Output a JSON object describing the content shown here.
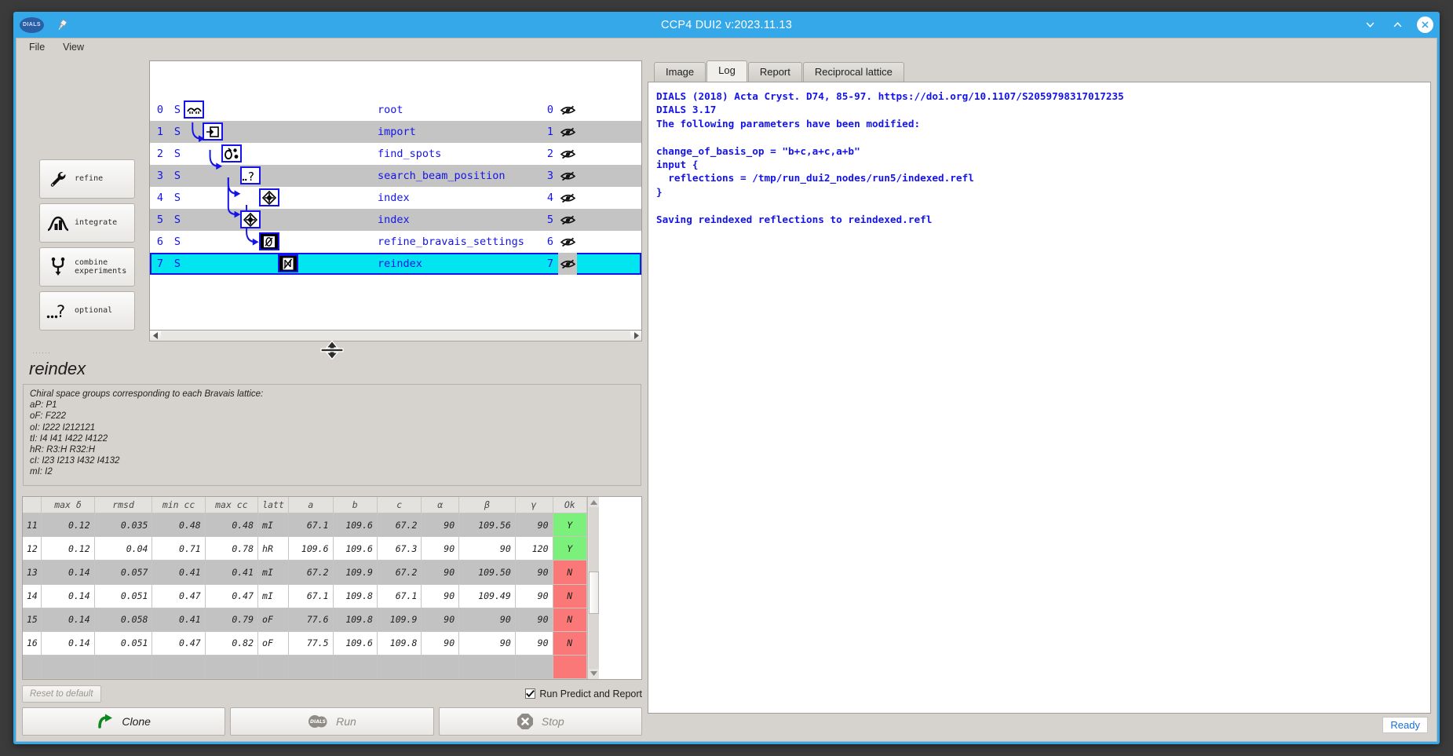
{
  "window": {
    "title": "CCP4 DUI2 v:2023.11.13",
    "logo_text": "DIALS",
    "controls": {
      "minimize": "chevron-down-icon",
      "maximize": "chevron-up-icon",
      "close": "close-icon"
    }
  },
  "menubar": {
    "items": [
      "File",
      "View"
    ]
  },
  "sidebuttons": [
    {
      "label": "refine",
      "icon": "wrench-icon"
    },
    {
      "label": "integrate",
      "icon": "histogram-icon"
    },
    {
      "label": "combine\nexperiments",
      "icon": "merge-icon"
    },
    {
      "label": "optional",
      "icon": "question-icon"
    }
  ],
  "tree": {
    "rows": [
      {
        "idx": "0",
        "status": "S",
        "name": "root",
        "num": "0",
        "icon": "eyelash-icon",
        "node_icon": "root-icon",
        "selected": false
      },
      {
        "idx": "1",
        "status": "S",
        "name": "import",
        "num": "1",
        "icon": "eyelash-icon",
        "node_icon": "import-icon",
        "selected": false
      },
      {
        "idx": "2",
        "status": "S",
        "name": "find_spots",
        "num": "2",
        "icon": "eyelash-icon",
        "node_icon": "spots-icon",
        "selected": false
      },
      {
        "idx": "3",
        "status": "S",
        "name": "search_beam_position",
        "num": "3",
        "icon": "eyelash-icon",
        "node_icon": "question-icon",
        "selected": false
      },
      {
        "idx": "4",
        "status": "S",
        "name": "index",
        "num": "4",
        "icon": "eyelash-icon",
        "node_icon": "index-icon",
        "selected": false
      },
      {
        "idx": "5",
        "status": "S",
        "name": "index",
        "num": "5",
        "icon": "eyelash-icon",
        "node_icon": "index-icon",
        "selected": false
      },
      {
        "idx": "6",
        "status": "S",
        "name": "refine_bravais_settings",
        "num": "6",
        "icon": "eyelash-icon",
        "node_icon": "bravais-icon",
        "selected": false
      },
      {
        "idx": "7",
        "status": "S",
        "name": "reindex",
        "num": "7",
        "icon": "eyelash-icon",
        "node_icon": "reindex-icon",
        "selected": true
      }
    ]
  },
  "reindex": {
    "title": "reindex",
    "description": [
      "Chiral space groups corresponding to each Bravais lattice:",
      "aP: P1",
      "oF: F222",
      "oI: I222 I212121",
      "tI: I4 I41 I422 I4122",
      "hR: R3:H R32:H",
      "cI: I23 I213 I432 I4132",
      "mI: I2"
    ]
  },
  "table": {
    "headers": [
      "max δ",
      "rmsd",
      "min cc",
      "max cc",
      "latt",
      "a",
      "b",
      "c",
      "α",
      "β",
      "γ",
      "Ok"
    ],
    "rows": [
      {
        "id": "11",
        "cells": [
          "0.12",
          "0.035",
          "0.48",
          "0.48",
          "mI",
          "67.1",
          "109.6",
          "67.2",
          "90",
          "109.56",
          "90"
        ],
        "ok": "Y"
      },
      {
        "id": "12",
        "cells": [
          "0.12",
          "0.04",
          "0.71",
          "0.78",
          "hR",
          "109.6",
          "109.6",
          "67.3",
          "90",
          "90",
          "120"
        ],
        "ok": "Y"
      },
      {
        "id": "13",
        "cells": [
          "0.14",
          "0.057",
          "0.41",
          "0.41",
          "mI",
          "67.2",
          "109.9",
          "67.2",
          "90",
          "109.50",
          "90"
        ],
        "ok": "N"
      },
      {
        "id": "14",
        "cells": [
          "0.14",
          "0.051",
          "0.47",
          "0.47",
          "mI",
          "67.1",
          "109.8",
          "67.1",
          "90",
          "109.49",
          "90"
        ],
        "ok": "N"
      },
      {
        "id": "15",
        "cells": [
          "0.14",
          "0.058",
          "0.41",
          "0.79",
          "oF",
          "77.6",
          "109.8",
          "109.9",
          "90",
          "90",
          "90"
        ],
        "ok": "N"
      },
      {
        "id": "16",
        "cells": [
          "0.14",
          "0.051",
          "0.47",
          "0.82",
          "oF",
          "77.5",
          "109.6",
          "109.8",
          "90",
          "90",
          "90"
        ],
        "ok": "N"
      }
    ]
  },
  "controls": {
    "reset_label": "Reset to default",
    "predict_label": "Run Predict and Report",
    "predict_checked": true,
    "clone_label": "Clone",
    "run_label": "Run",
    "stop_label": "Stop"
  },
  "tabs": [
    {
      "label": "Image",
      "active": false
    },
    {
      "label": "Log",
      "active": true
    },
    {
      "label": "Report",
      "active": false
    },
    {
      "label": "Reciprocal lattice",
      "active": false
    }
  ],
  "log": {
    "lines": [
      "DIALS (2018) Acta Cryst. D74, 85-97. https://doi.org/10.1107/S2059798317017235",
      "DIALS 3.17",
      "The following parameters have been modified:",
      "",
      "change_of_basis_op = \"b+c,a+c,a+b\"",
      "input {",
      "  reflections = /tmp/run_dui2_nodes/run5/indexed.refl",
      "}",
      "",
      "Saving reindexed reflections to reindexed.refl"
    ]
  },
  "status": {
    "ready": "Ready"
  },
  "colors": {
    "titlebar": "#34a8e8",
    "selection": "#00e5f0",
    "tree_text": "#1414e8",
    "ok_yes": "#7bf07b",
    "ok_no": "#fa7878",
    "log_text": "#1414e8"
  }
}
